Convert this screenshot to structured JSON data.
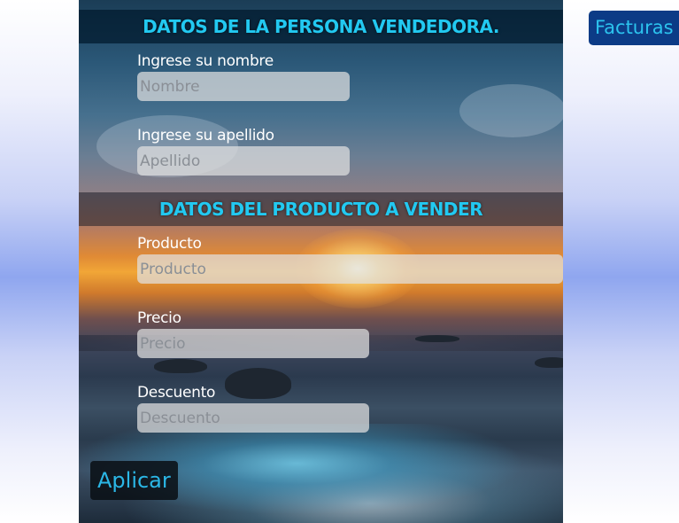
{
  "nav": {
    "facturas_label": "Facturas"
  },
  "seller_section": {
    "title": "DATOS DE LA PERSONA VENDEDORA.",
    "name_label": "Ingrese su nombre",
    "name_placeholder": "Nombre",
    "surname_label": "Ingrese su apellido",
    "surname_placeholder": "Apellido"
  },
  "product_section": {
    "title": "DATOS DEL PRODUCTO A VENDER",
    "product_label": "Producto",
    "product_placeholder": "Producto",
    "price_label": "Precio",
    "price_placeholder": "Precio",
    "discount_label": "Descuento",
    "discount_placeholder": "Descuento"
  },
  "actions": {
    "apply_label": "Aplicar"
  },
  "colors": {
    "heading_accent": "#22c9f1",
    "button_text": "#2bb7e6",
    "facturas_background": "#0c3b86"
  }
}
